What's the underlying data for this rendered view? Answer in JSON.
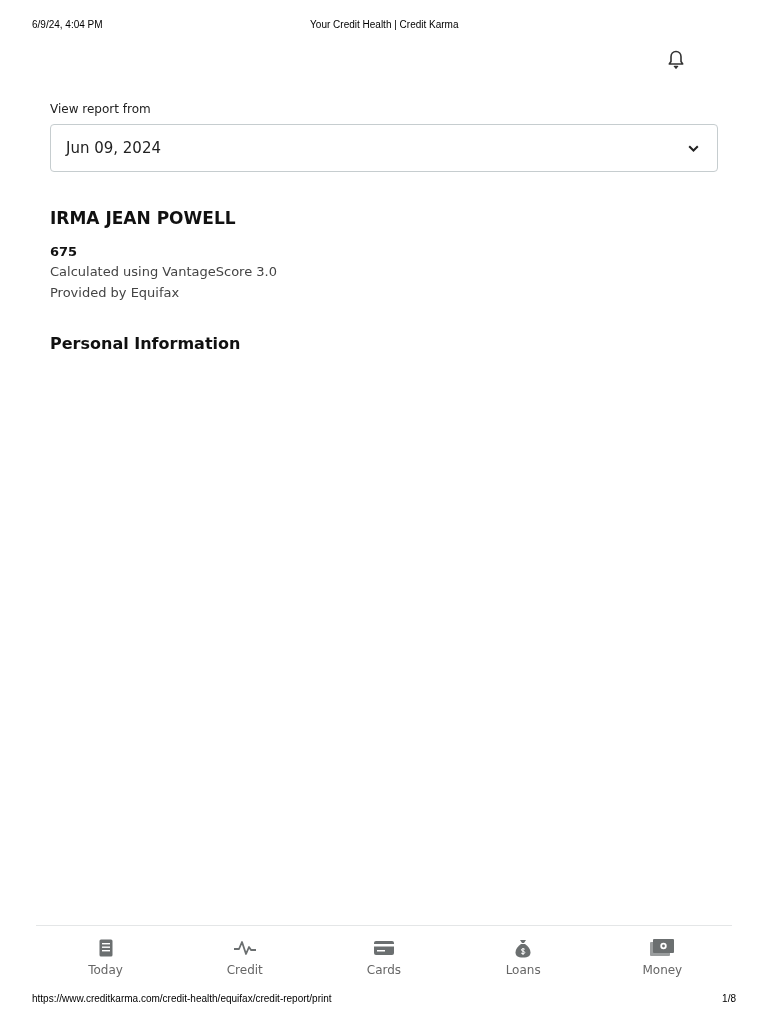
{
  "print_header": {
    "date": "6/9/24, 4:04 PM",
    "title": "Your Credit Health | Credit Karma"
  },
  "report_selector": {
    "label": "View report from",
    "value": "Jun 09, 2024"
  },
  "report": {
    "name": "IRMA JEAN POWELL",
    "score": "675",
    "model": "Calculated using VantageScore 3.0",
    "provider": "Provided by Equifax"
  },
  "section_heading": "Personal Information",
  "bottom_nav": [
    {
      "label": "Today",
      "kind": "today"
    },
    {
      "label": "Credit",
      "kind": "credit"
    },
    {
      "label": "Cards",
      "kind": "cards"
    },
    {
      "label": "Loans",
      "kind": "loans"
    },
    {
      "label": "Money",
      "kind": "money"
    }
  ],
  "print_footer": {
    "url": "https://www.creditkarma.com/credit-health/equifax/credit-report/print",
    "page": "1/8"
  }
}
